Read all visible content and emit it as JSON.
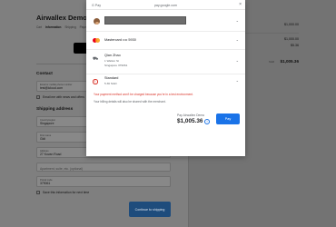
{
  "checkout": {
    "brand": "Airwallex Demo",
    "breadcrumbs": [
      "Cart",
      "Information",
      "Shipping",
      "Payment"
    ],
    "contact_title": "Contact",
    "email_label": "Email or mobile phone number",
    "email_value": "test@icloud.com",
    "email_news_label": "Email me with news and offers",
    "shipping_title": "Shipping address",
    "country_label": "Country/region",
    "country_value": "Singapore",
    "first_name_label": "First name",
    "first_name_value": "Gidi",
    "address_label": "Address",
    "address_value": "27 Kovan Road",
    "apartment_placeholder": "Apartment, suite, etc. (optional)",
    "postal_label": "Postal code",
    "postal_value": "379061",
    "save_info_label": "Save this information for next time",
    "continue_label": "Continue to shipping"
  },
  "summary": {
    "item_price": "$1,000.00",
    "subtotal": "$1,000.00",
    "shipping": "$5.36",
    "currency": "SGD",
    "total": "$1,005.36"
  },
  "gpay_dialog": {
    "logo": "G Pay",
    "url": "pay.google.com",
    "close_icon": "close-icon",
    "card": "Mastercard •••• 5930",
    "shipping_name": "Qian Zhao",
    "shipping_address_1": "1 Walton St",
    "shipping_address_2": "Singapore 379061",
    "shipping_method": "Standard",
    "shipping_price": "5.36 SGD",
    "warning": "Your payment method won't be charged because you're in a test environment.",
    "share_note": "Your billing details will also be shared with the merchant.",
    "pay_to": "Pay Airwallex Demo",
    "amount": "$1,005.36",
    "pay_button": "Pay"
  },
  "colors": {
    "pay_button": "#1a73e8",
    "warning": "#d93025",
    "continue_button": "#1e4c7c"
  }
}
